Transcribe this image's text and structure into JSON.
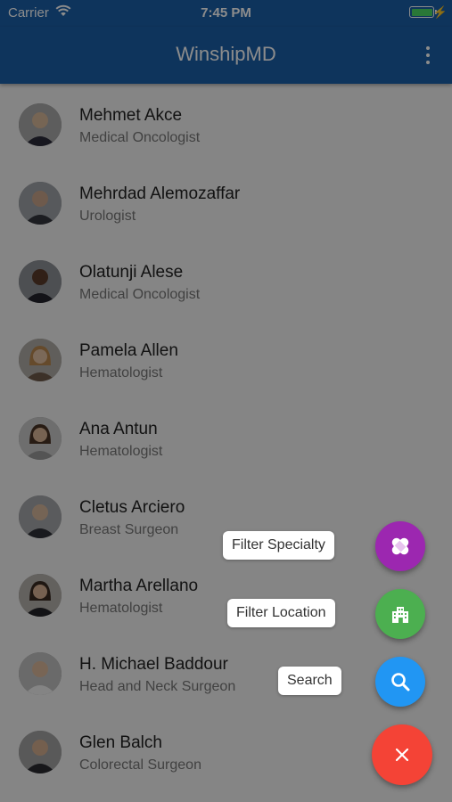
{
  "status_bar": {
    "carrier": "Carrier",
    "time": "7:45 PM"
  },
  "app_bar": {
    "title": "WinshipMD"
  },
  "doctors": [
    {
      "name": "Mehmet Akce",
      "specialty": "Medical Oncologist"
    },
    {
      "name": "Mehrdad Alemozaffar",
      "specialty": "Urologist"
    },
    {
      "name": "Olatunji Alese",
      "specialty": "Medical Oncologist"
    },
    {
      "name": "Pamela Allen",
      "specialty": "Hematologist"
    },
    {
      "name": "Ana Antun",
      "specialty": "Hematologist"
    },
    {
      "name": "Cletus Arciero",
      "specialty": "Breast Surgeon"
    },
    {
      "name": "Martha Arellano",
      "specialty": "Hematologist"
    },
    {
      "name": "H. Michael Baddour",
      "specialty": "Head and Neck Surgeon"
    },
    {
      "name": "Glen Balch",
      "specialty": "Colorectal Surgeon"
    }
  ],
  "speed_dial": {
    "filter_specialty_label": "Filter Specialty",
    "filter_location_label": "Filter Location",
    "search_label": "Search",
    "filter_specialty_icon": "bandage-icon",
    "filter_location_icon": "building-icon",
    "search_icon": "search-icon",
    "close_icon": "close-icon"
  },
  "colors": {
    "app_bar": "#1b5fa8",
    "filter_specialty": "#9c27b0",
    "filter_location": "#4caf50",
    "search": "#2196f3",
    "close": "#f44336"
  }
}
